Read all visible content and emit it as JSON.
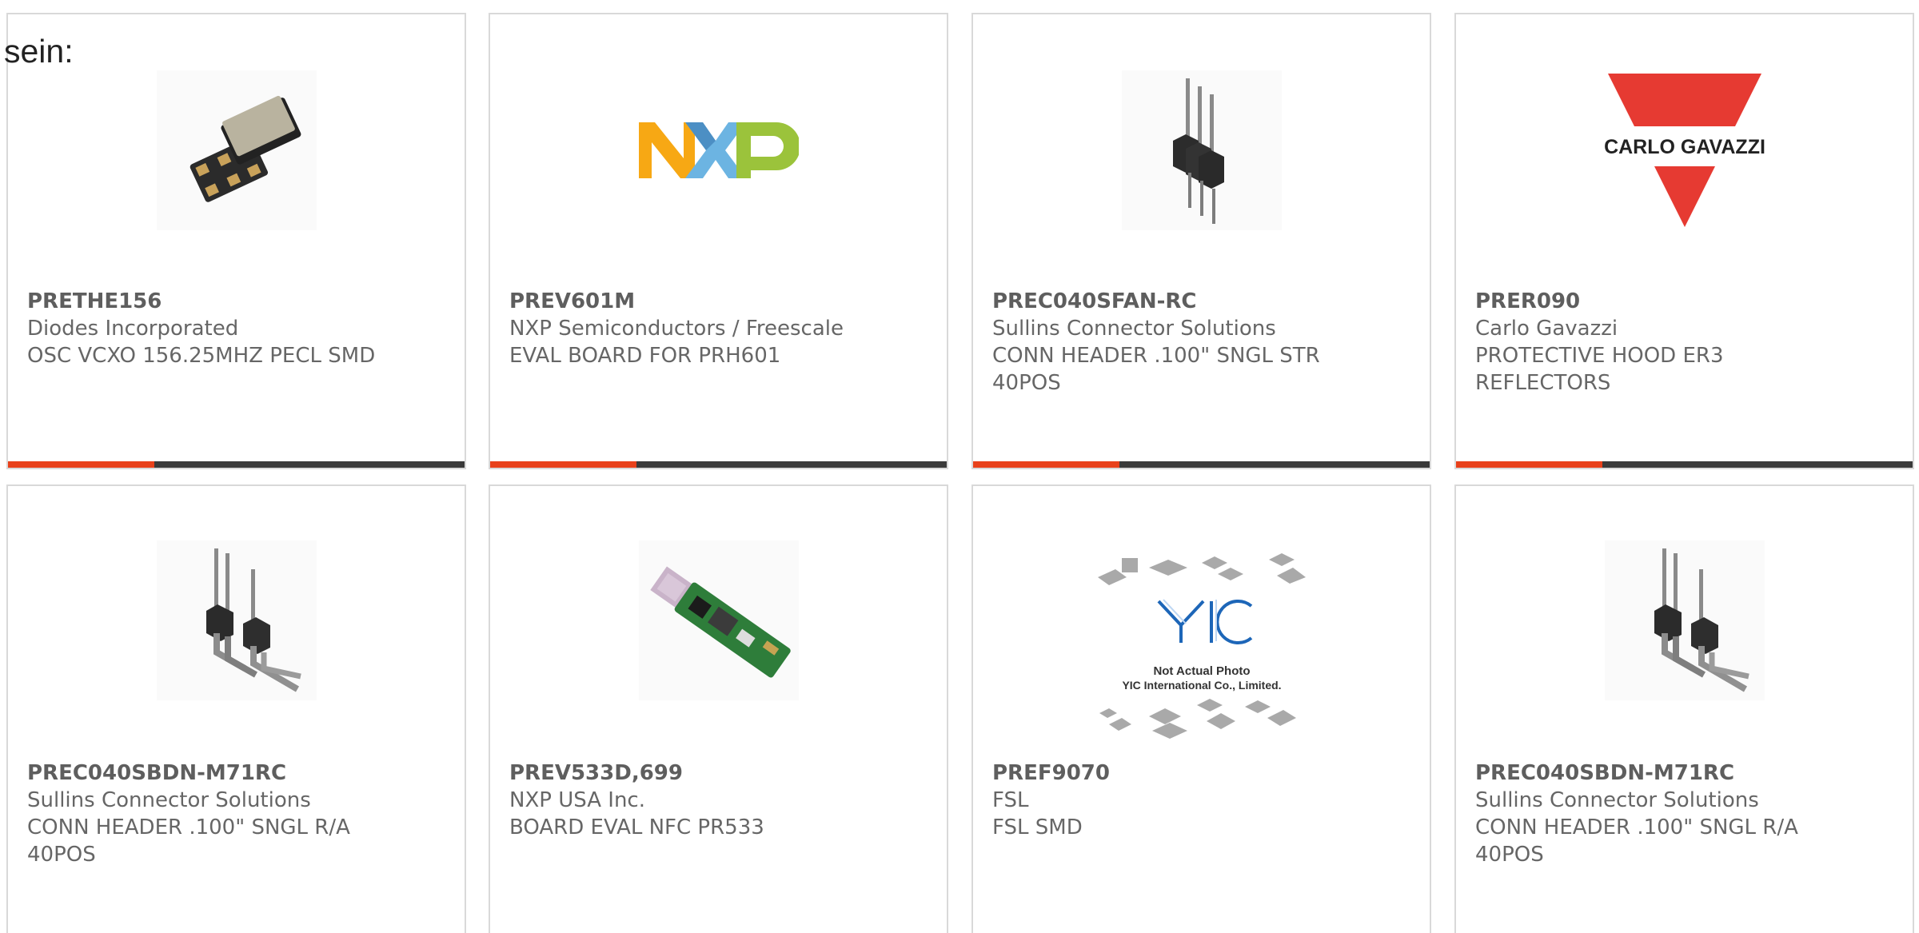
{
  "intro_text": "sein:",
  "colors": {
    "accent": "#e8411b",
    "bar_track": "#3a3a3a",
    "card_border": "#d9d9d9",
    "text": "#666666"
  },
  "products": [
    {
      "part_number": "PRETHE156",
      "manufacturer": "Diodes Incorporated",
      "description": "OSC VCXO 156.25MHZ PECL SMD",
      "image": "smd-oscillator-image",
      "progress": 0.32
    },
    {
      "part_number": "PREV601M",
      "manufacturer": "NXP Semiconductors / Freescale",
      "description": "EVAL BOARD FOR PRH601",
      "image": "nxp-logo-image",
      "progress": 0.32
    },
    {
      "part_number": "PREC040SFAN-RC",
      "manufacturer": "Sullins Connector Solutions",
      "description": "CONN HEADER .100\" SNGL STR 40POS",
      "image": "straight-pin-header-image",
      "progress": 0.32
    },
    {
      "part_number": "PRER090",
      "manufacturer": "Carlo Gavazzi",
      "description": "PROTECTIVE HOOD ER3 REFLECTORS",
      "image": "carlo-gavazzi-logo-image",
      "logo_text": "CARLO GAVAZZI",
      "progress": 0.32
    },
    {
      "part_number": "PREC040SBDN-M71RC",
      "manufacturer": "Sullins Connector Solutions",
      "description": "CONN HEADER .100\" SNGL R/A 40POS",
      "image": "right-angle-pin-header-image"
    },
    {
      "part_number": "PREV533D,699",
      "manufacturer": "NXP USA Inc.",
      "description": "BOARD EVAL NFC PR533",
      "image": "usb-nfc-board-image"
    },
    {
      "part_number": "PREF9070",
      "manufacturer": "FSL",
      "description": "FSL SMD",
      "image": "yic-placeholder-image",
      "placeholder_line1": "Not Actual Photo",
      "placeholder_line2": "YIC International Co., Limited."
    },
    {
      "part_number": "PREC040SBDN-M71RC",
      "manufacturer": "Sullins Connector Solutions",
      "description": "CONN HEADER .100\" SNGL R/A 40POS",
      "image": "right-angle-pin-header-image"
    }
  ]
}
